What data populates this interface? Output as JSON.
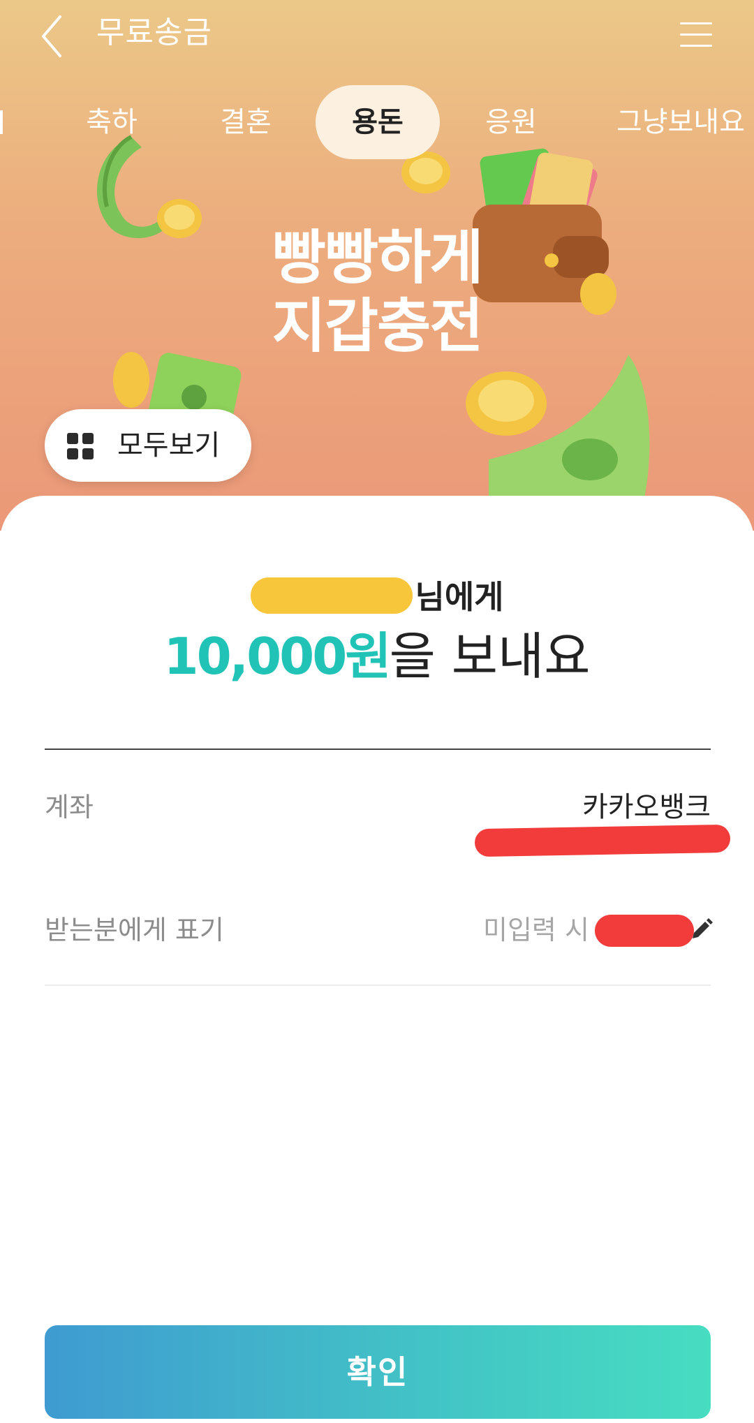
{
  "header": {
    "title": "무료송금"
  },
  "tabs": [
    {
      "label": "축하",
      "active": false
    },
    {
      "label": "결혼",
      "active": false
    },
    {
      "label": "용돈",
      "active": true
    },
    {
      "label": "응원",
      "active": false
    },
    {
      "label": "그냥보내요",
      "active": false
    }
  ],
  "banner": {
    "headline_line1": "빵빵하게",
    "headline_line2": "지갑충전",
    "view_all_label": "모두보기"
  },
  "transfer": {
    "recipient_suffix": "님에게",
    "amount": "10,000원",
    "amount_suffix": "을 보내요"
  },
  "account": {
    "label": "계좌",
    "bank": "카카오뱅크"
  },
  "display_name": {
    "label": "받는분에게 표기",
    "placeholder": "미입력 시 ㅎ"
  },
  "confirm": {
    "label": "확인"
  },
  "colors": {
    "amount": "#21c3b6",
    "active_tab_bg": "#fcf0e1",
    "confirm_start": "#3f9bd1",
    "confirm_end": "#47ddc1"
  },
  "icons": {
    "back": "chevron-left-icon",
    "menu": "hamburger-menu-icon",
    "view_all": "grid-icon",
    "edit": "pencil-icon"
  }
}
